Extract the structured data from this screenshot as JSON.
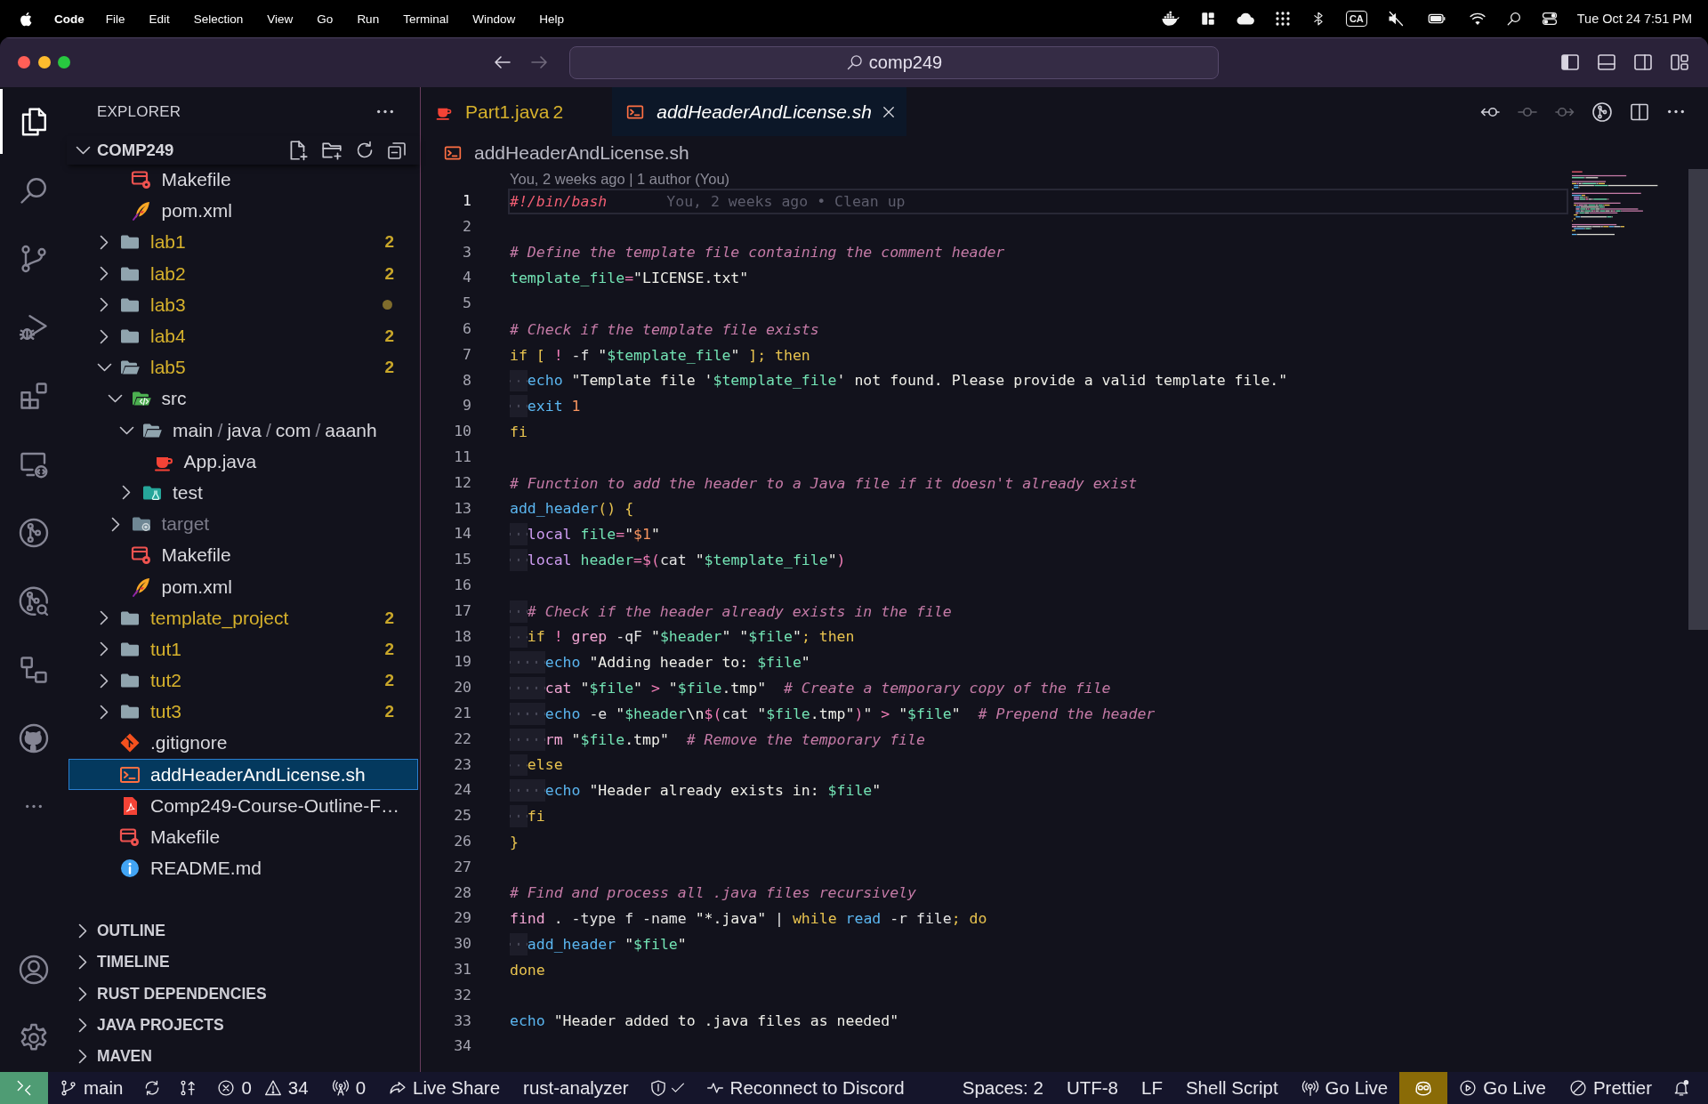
{
  "menu_bar": {
    "app_name": "Code",
    "menus": [
      "File",
      "Edit",
      "Selection",
      "View",
      "Go",
      "Run",
      "Terminal",
      "Window",
      "Help"
    ],
    "input_source": "CA",
    "clock": "Tue Oct 24 7:51 PM"
  },
  "title_bar": {
    "back": {
      "disabled": false
    },
    "forward": {
      "disabled": true
    },
    "command_center": "comp249"
  },
  "activity_bar": {
    "items": [
      {
        "kind": "explorer",
        "selected": true
      },
      {
        "kind": "search",
        "selected": false
      },
      {
        "kind": "scm",
        "selected": false
      },
      {
        "kind": "debug",
        "selected": false
      },
      {
        "kind": "extensions",
        "selected": false
      },
      {
        "kind": "remote",
        "selected": false
      },
      {
        "kind": "gitlens",
        "selected": false
      },
      {
        "kind": "inspect",
        "selected": false
      },
      {
        "kind": "graph",
        "selected": false
      },
      {
        "kind": "github",
        "selected": false
      },
      {
        "kind": "more",
        "selected": false
      }
    ],
    "bottom_items": [
      {
        "kind": "accounts",
        "selected": false
      },
      {
        "kind": "manage",
        "selected": false
      }
    ]
  },
  "sidebar": {
    "title": "EXPLORER",
    "folder": {
      "label": "COMP249",
      "expanded": true
    },
    "tree": [
      {
        "children": [
          {
            "label": "Makefile",
            "kind": "makefile",
            "modified": false,
            "ignored": false,
            "selected": false
          },
          {
            "label": "pom.xml",
            "kind": "xml",
            "modified": false,
            "ignored": false,
            "selected": false
          }
        ]
      },
      {
        "label": "lab1",
        "kind": "folder",
        "expanded": false,
        "modified": true,
        "ignored": false,
        "selected": false,
        "decoration": {
          "kind": "count",
          "text": "2"
        }
      },
      {
        "label": "lab2",
        "kind": "folder",
        "expanded": false,
        "modified": true,
        "ignored": false,
        "selected": false,
        "decoration": {
          "kind": "count",
          "text": "2"
        }
      },
      {
        "label": "lab3",
        "kind": "folder",
        "expanded": false,
        "modified": true,
        "ignored": false,
        "selected": false,
        "decoration": {
          "kind": "dot"
        }
      },
      {
        "label": "lab4",
        "kind": "folder",
        "expanded": false,
        "modified": true,
        "ignored": false,
        "selected": false,
        "decoration": {
          "kind": "count",
          "text": "2"
        }
      },
      {
        "label": "lab5",
        "kind": "folder",
        "expanded": true,
        "modified": true,
        "ignored": false,
        "selected": false,
        "decoration": {
          "kind": "count",
          "text": "2"
        },
        "children": [
          {
            "label": "src",
            "kind": "codefolder",
            "expanded": true,
            "modified": false,
            "ignored": false,
            "selected": false,
            "children": [
              {
                "segments": [
                  "main",
                  "java",
                  "com",
                  "aaanh"
                ],
                "separator": "/",
                "kind": "folder",
                "expanded": true,
                "modified": false,
                "ignored": false,
                "selected": false,
                "children": [
                  {
                    "label": "App.java",
                    "kind": "java",
                    "modified": false,
                    "ignored": false,
                    "selected": false
                  }
                ]
              },
              {
                "label": "test",
                "kind": "testfolder",
                "expanded": false,
                "modified": false,
                "ignored": false,
                "selected": false
              }
            ]
          },
          {
            "label": "target",
            "kind": "buildfolder",
            "expanded": false,
            "modified": false,
            "ignored": true,
            "selected": false
          },
          {
            "label": "Makefile",
            "kind": "makefile",
            "modified": false,
            "ignored": false,
            "selected": false
          },
          {
            "label": "pom.xml",
            "kind": "xml",
            "modified": false,
            "ignored": false,
            "selected": false
          }
        ]
      },
      {
        "label": "template_project",
        "kind": "folder",
        "expanded": false,
        "modified": true,
        "ignored": false,
        "selected": false,
        "decoration": {
          "kind": "count",
          "text": "2"
        }
      },
      {
        "label": "tut1",
        "kind": "folder",
        "expanded": false,
        "modified": true,
        "ignored": false,
        "selected": false,
        "decoration": {
          "kind": "count",
          "text": "2"
        }
      },
      {
        "label": "tut2",
        "kind": "folder",
        "expanded": false,
        "modified": true,
        "ignored": false,
        "selected": false,
        "decoration": {
          "kind": "count",
          "text": "2"
        }
      },
      {
        "label": "tut3",
        "kind": "folder",
        "expanded": false,
        "modified": true,
        "ignored": false,
        "selected": false,
        "decoration": {
          "kind": "count",
          "text": "2"
        }
      },
      {
        "label": ".gitignore",
        "kind": "git",
        "modified": false,
        "ignored": false,
        "selected": false
      },
      {
        "label": "addHeaderAndLicense.sh",
        "kind": "shell",
        "modified": false,
        "ignored": false,
        "selected": true
      },
      {
        "label": "Comp249-Course-Outline-F…",
        "kind": "pdf",
        "modified": false,
        "ignored": false,
        "selected": false
      },
      {
        "label": "Makefile",
        "kind": "makefile",
        "modified": false,
        "ignored": false,
        "selected": false
      },
      {
        "label": "README.md",
        "kind": "info",
        "modified": false,
        "ignored": false,
        "selected": false
      }
    ],
    "panes": [
      {
        "label": "OUTLINE",
        "expanded": false
      },
      {
        "label": "TIMELINE",
        "expanded": false
      },
      {
        "label": "RUST DEPENDENCIES",
        "expanded": false
      },
      {
        "label": "JAVA PROJECTS",
        "expanded": false
      },
      {
        "label": "MAVEN",
        "expanded": false
      }
    ]
  },
  "editor": {
    "tabs": [
      {
        "label": "Part1.java",
        "kind": "java",
        "badge": "2",
        "modified": true,
        "preview": false,
        "selected": false
      },
      {
        "label": "addHeaderAndLicense.sh",
        "kind": "shell",
        "modified": false,
        "preview": true,
        "selected": true
      }
    ],
    "actions": [
      {
        "kind": "previous",
        "disabled": false
      },
      {
        "kind": "commit",
        "disabled": true
      },
      {
        "kind": "next",
        "disabled": true
      },
      {
        "kind": "graph",
        "disabled": false
      },
      {
        "kind": "split",
        "disabled": false
      },
      {
        "kind": "more",
        "disabled": false
      }
    ],
    "breadcrumb": {
      "label": "addHeaderAndLicense.sh",
      "kind": "shell"
    },
    "codelens": "You, 2 weeks ago | 1 author (You)",
    "lines": [
      {
        "number": "1",
        "current": true,
        "tokens": [
          {
            "text": "#!/bin/bash",
            "kind": "shebang"
          }
        ],
        "blame": "You, 2 weeks ago • Clean up"
      },
      {
        "number": "2",
        "current": false
      },
      {
        "number": "3",
        "current": false,
        "tokens": [
          {
            "text": "# Define the template file containing the comment header",
            "kind": "comment"
          }
        ]
      },
      {
        "number": "4",
        "current": false,
        "tokens": [
          {
            "text": "template_file",
            "kind": "variable"
          },
          {
            "text": "=",
            "kind": "operator"
          },
          {
            "text": "\"LICENSE.txt\"",
            "kind": "string"
          }
        ]
      },
      {
        "number": "5",
        "current": false
      },
      {
        "number": "6",
        "current": false,
        "tokens": [
          {
            "text": "# Check if the template file exists",
            "kind": "comment"
          }
        ]
      },
      {
        "number": "7",
        "current": false,
        "tokens": [
          {
            "text": "if [ ",
            "kind": "keyword"
          },
          {
            "text": "! ",
            "kind": "operator"
          },
          {
            "text": "-f ",
            "kind": "plain"
          },
          {
            "text": "\"",
            "kind": "string"
          },
          {
            "text": "$template_file",
            "kind": "variable"
          },
          {
            "text": "\" ",
            "kind": "string"
          },
          {
            "text": "]; then",
            "kind": "keyword"
          }
        ],
        "children": [
          {
            "number": "8",
            "current": false,
            "tokens": [
              {
                "text": "echo ",
                "kind": "builtin"
              },
              {
                "text": "\"Template file '",
                "kind": "string"
              },
              {
                "text": "$template_file",
                "kind": "variable"
              },
              {
                "text": "' not found. Please provide a valid template file.\"",
                "kind": "string"
              }
            ]
          },
          {
            "number": "9",
            "current": false,
            "tokens": [
              {
                "text": "exit ",
                "kind": "builtin"
              },
              {
                "text": "1",
                "kind": "number"
              }
            ]
          }
        ]
      },
      {
        "number": "10",
        "current": false,
        "tokens": [
          {
            "text": "fi",
            "kind": "keyword"
          }
        ]
      },
      {
        "number": "11",
        "current": false
      },
      {
        "number": "12",
        "current": false,
        "tokens": [
          {
            "text": "# Function to add the header to a Java file if it doesn't already exist",
            "kind": "comment"
          }
        ]
      },
      {
        "number": "13",
        "current": false,
        "tokens": [
          {
            "text": "add_header",
            "kind": "builtin"
          },
          {
            "text": "() {",
            "kind": "keyword"
          }
        ],
        "children": [
          {
            "number": "14",
            "current": false,
            "tokens": [
              {
                "text": "local ",
                "kind": "storage"
              },
              {
                "text": "file",
                "kind": "variable"
              },
              {
                "text": "=",
                "kind": "operator"
              },
              {
                "text": "\"",
                "kind": "string"
              },
              {
                "text": "$1",
                "kind": "number"
              },
              {
                "text": "\"",
                "kind": "string"
              }
            ]
          },
          {
            "number": "15",
            "current": false,
            "tokens": [
              {
                "text": "local ",
                "kind": "storage"
              },
              {
                "text": "header",
                "kind": "variable"
              },
              {
                "text": "=$(",
                "kind": "operator"
              },
              {
                "text": "cat ",
                "kind": "plain"
              },
              {
                "text": "\"",
                "kind": "string"
              },
              {
                "text": "$template_file",
                "kind": "variable"
              },
              {
                "text": "\"",
                "kind": "string"
              },
              {
                "text": ")",
                "kind": "operator"
              }
            ]
          },
          {
            "number": "16",
            "current": false
          },
          {
            "number": "17",
            "current": false,
            "tokens": [
              {
                "text": "# Check if the header already exists in the file",
                "kind": "comment"
              }
            ]
          },
          {
            "number": "18",
            "current": false,
            "tokens": [
              {
                "text": "if ",
                "kind": "keyword"
              },
              {
                "text": "! ",
                "kind": "operator"
              },
              {
                "text": "grep ",
                "kind": "command"
              },
              {
                "text": "-qF ",
                "kind": "plain"
              },
              {
                "text": "\"",
                "kind": "string"
              },
              {
                "text": "$header",
                "kind": "variable"
              },
              {
                "text": "\" \"",
                "kind": "string"
              },
              {
                "text": "$file",
                "kind": "variable"
              },
              {
                "text": "\"",
                "kind": "string"
              },
              {
                "text": "; then",
                "kind": "keyword"
              }
            ],
            "children": [
              {
                "number": "19",
                "current": false,
                "tokens": [
                  {
                    "text": "echo ",
                    "kind": "builtin"
                  },
                  {
                    "text": "\"Adding header to: ",
                    "kind": "string"
                  },
                  {
                    "text": "$file",
                    "kind": "variable"
                  },
                  {
                    "text": "\"",
                    "kind": "string"
                  }
                ]
              },
              {
                "number": "20",
                "current": false,
                "tokens": [
                  {
                    "text": "cat ",
                    "kind": "command"
                  },
                  {
                    "text": "\"",
                    "kind": "string"
                  },
                  {
                    "text": "$file",
                    "kind": "variable"
                  },
                  {
                    "text": "\" ",
                    "kind": "string"
                  },
                  {
                    "text": "> ",
                    "kind": "operator"
                  },
                  {
                    "text": "\"",
                    "kind": "string"
                  },
                  {
                    "text": "$file",
                    "kind": "variable"
                  },
                  {
                    "text": ".tmp\"",
                    "kind": "string"
                  },
                  {
                    "text": "  # Create a temporary copy of the file",
                    "kind": "comment"
                  }
                ]
              },
              {
                "number": "21",
                "current": false,
                "tokens": [
                  {
                    "text": "echo ",
                    "kind": "builtin"
                  },
                  {
                    "text": "-e ",
                    "kind": "plain"
                  },
                  {
                    "text": "\"",
                    "kind": "string"
                  },
                  {
                    "text": "$header",
                    "kind": "variable"
                  },
                  {
                    "text": "\\n",
                    "kind": "string"
                  },
                  {
                    "text": "$(",
                    "kind": "operator"
                  },
                  {
                    "text": "cat ",
                    "kind": "plain"
                  },
                  {
                    "text": "\"",
                    "kind": "string"
                  },
                  {
                    "text": "$file",
                    "kind": "variable"
                  },
                  {
                    "text": ".tmp\"",
                    "kind": "string"
                  },
                  {
                    "text": ")",
                    "kind": "operator"
                  },
                  {
                    "text": "\" ",
                    "kind": "string"
                  },
                  {
                    "text": "> ",
                    "kind": "operator"
                  },
                  {
                    "text": "\"",
                    "kind": "string"
                  },
                  {
                    "text": "$file",
                    "kind": "variable"
                  },
                  {
                    "text": "\"",
                    "kind": "string"
                  },
                  {
                    "text": "  # Prepend the header",
                    "kind": "comment"
                  }
                ]
              },
              {
                "number": "22",
                "current": false,
                "tokens": [
                  {
                    "text": "rm ",
                    "kind": "command"
                  },
                  {
                    "text": "\"",
                    "kind": "string"
                  },
                  {
                    "text": "$file",
                    "kind": "variable"
                  },
                  {
                    "text": ".tmp\"",
                    "kind": "string"
                  },
                  {
                    "text": "  # Remove the temporary file",
                    "kind": "comment"
                  }
                ]
              }
            ]
          },
          {
            "number": "23",
            "current": false,
            "tokens": [
              {
                "text": "else",
                "kind": "keyword"
              }
            ],
            "children": [
              {
                "number": "24",
                "current": false,
                "tokens": [
                  {
                    "text": "echo ",
                    "kind": "builtin"
                  },
                  {
                    "text": "\"Header already exists in: ",
                    "kind": "string"
                  },
                  {
                    "text": "$file",
                    "kind": "variable"
                  },
                  {
                    "text": "\"",
                    "kind": "string"
                  }
                ]
              }
            ]
          },
          {
            "number": "25",
            "current": false,
            "tokens": [
              {
                "text": "fi",
                "kind": "keyword"
              }
            ]
          }
        ]
      },
      {
        "number": "26",
        "current": false,
        "tokens": [
          {
            "text": "}",
            "kind": "keyword"
          }
        ]
      },
      {
        "number": "27",
        "current": false
      },
      {
        "number": "28",
        "current": false,
        "tokens": [
          {
            "text": "# Find and process all .java files recursively",
            "kind": "comment"
          }
        ]
      },
      {
        "number": "29",
        "current": false,
        "tokens": [
          {
            "text": "find ",
            "kind": "command"
          },
          {
            "text": ". -type f -name ",
            "kind": "plain"
          },
          {
            "text": "\"*.java\" ",
            "kind": "string"
          },
          {
            "text": "| ",
            "kind": "plain"
          },
          {
            "text": "while ",
            "kind": "keyword"
          },
          {
            "text": "read ",
            "kind": "builtin"
          },
          {
            "text": "-r file",
            "kind": "plain"
          },
          {
            "text": "; do",
            "kind": "keyword"
          }
        ],
        "children": [
          {
            "number": "30",
            "current": false,
            "tokens": [
              {
                "text": "add_header ",
                "kind": "builtin"
              },
              {
                "text": "\"",
                "kind": "string"
              },
              {
                "text": "$file",
                "kind": "variable"
              },
              {
                "text": "\"",
                "kind": "string"
              }
            ]
          }
        ]
      },
      {
        "number": "31",
        "current": false,
        "tokens": [
          {
            "text": "done",
            "kind": "keyword"
          }
        ]
      },
      {
        "number": "32",
        "current": false
      },
      {
        "number": "33",
        "current": false,
        "tokens": [
          {
            "text": "echo ",
            "kind": "builtin"
          },
          {
            "text": "\"Header added to .java files as needed\"",
            "kind": "string"
          }
        ]
      },
      {
        "number": "34",
        "current": false
      }
    ]
  },
  "status_bar": {
    "left": [
      {
        "kind": "remote"
      },
      {
        "kind": "branch",
        "text": "main"
      },
      {
        "kind": "sync"
      },
      {
        "kind": "graph"
      },
      {
        "kind": "problems",
        "errors": "0",
        "warnings": "34"
      },
      {
        "kind": "ports",
        "text": "0"
      },
      {
        "kind": "share",
        "text": "Live Share"
      },
      {
        "kind": "plain",
        "text": "rust-analyzer"
      },
      {
        "kind": "shield"
      },
      {
        "kind": "pulse",
        "text": "Reconnect to Discord"
      }
    ],
    "right": [
      {
        "kind": "plain",
        "text": "Spaces: 2"
      },
      {
        "kind": "plain",
        "text": "UTF-8"
      },
      {
        "kind": "plain",
        "text": "LF"
      },
      {
        "kind": "plain",
        "text": "Shell Script"
      },
      {
        "kind": "broadcast",
        "text": "Go Live"
      },
      {
        "kind": "assistant"
      },
      {
        "kind": "play",
        "text": "Go Live"
      },
      {
        "kind": "blocked",
        "text": "Prettier"
      },
      {
        "kind": "bell"
      }
    ]
  }
}
